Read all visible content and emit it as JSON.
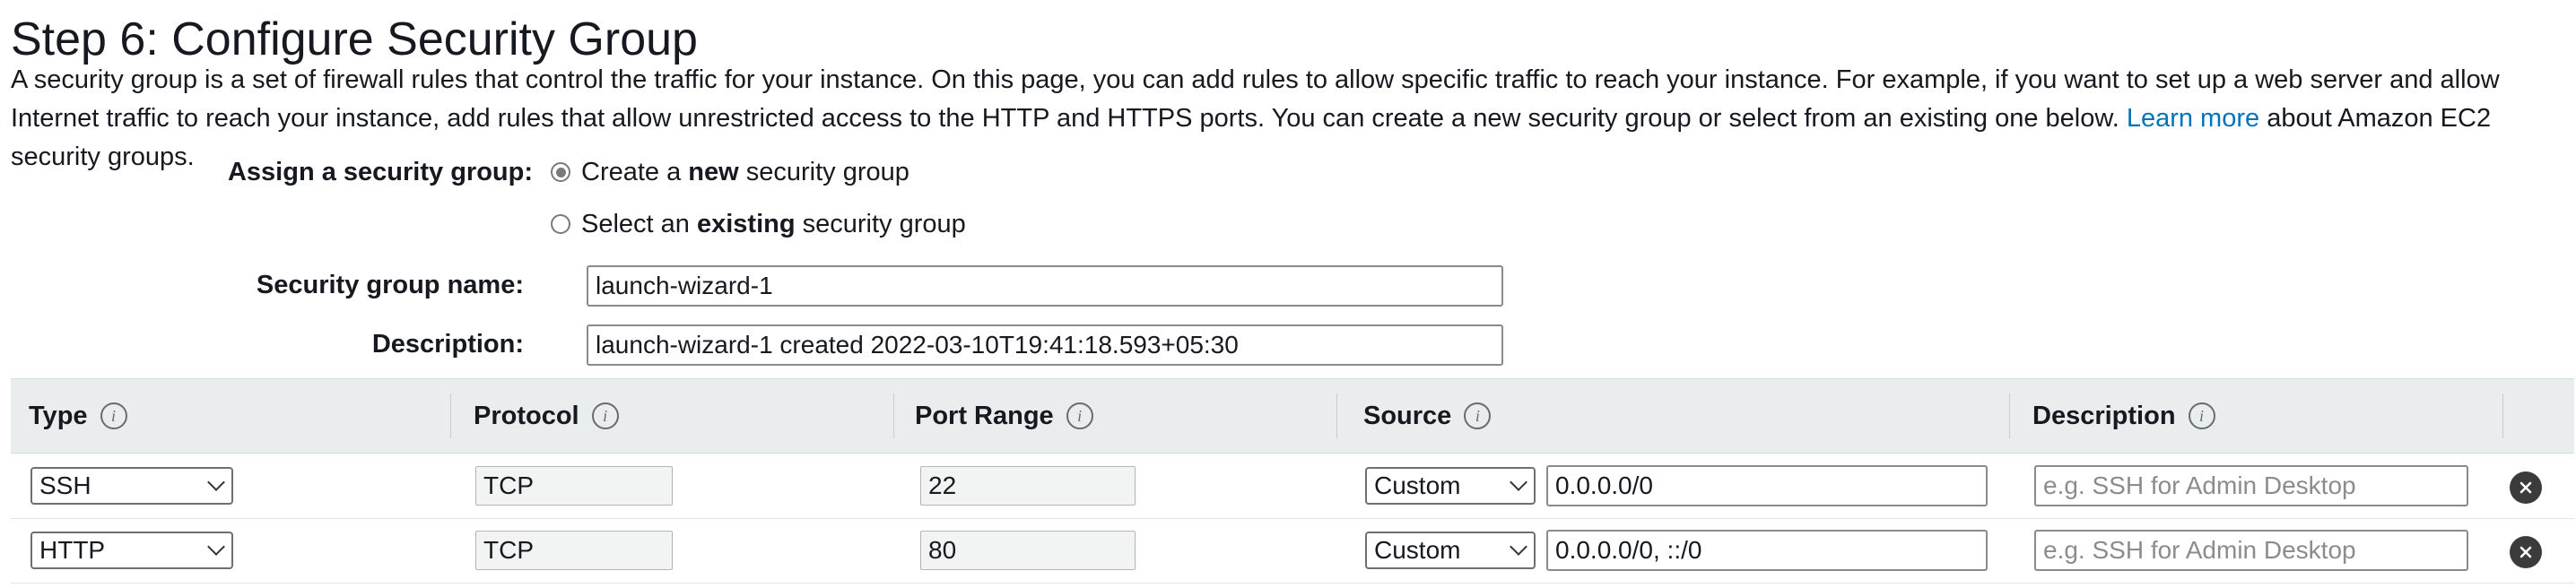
{
  "heading": "Step 6: Configure Security Group",
  "intro": {
    "text_before": "A security group is a set of firewall rules that control the traffic for your instance. On this page, you can add rules to allow specific traffic to reach your instance. For example, if you want to set up a web server and allow Internet traffic to reach your instance, add rules that allow unrestricted access to the HTTP and HTTPS ports. You can create a new security group or select from an existing one below.",
    "link": "Learn more",
    "text_after": "about Amazon EC2 security groups."
  },
  "assign": {
    "label": "Assign a security group:",
    "options": [
      {
        "prefix": "Create a ",
        "bold": "new",
        "suffix": " security group",
        "selected": true
      },
      {
        "prefix": "Select an ",
        "bold": "existing",
        "suffix": " security group",
        "selected": false
      }
    ]
  },
  "group_name": {
    "label": "Security group name:",
    "value": "launch-wizard-1"
  },
  "group_description": {
    "label": "Description:",
    "value": "launch-wizard-1 created 2022-03-10T19:41:18.593+05:30"
  },
  "table": {
    "headers": {
      "type": "Type",
      "protocol": "Protocol",
      "port_range": "Port Range",
      "source": "Source",
      "description": "Description"
    },
    "rows": [
      {
        "type": "SSH",
        "protocol": "TCP",
        "port": "22",
        "source_type": "Custom",
        "source_value": "0.0.0.0/0",
        "description_placeholder": "e.g. SSH for Admin Desktop"
      },
      {
        "type": "HTTP",
        "protocol": "TCP",
        "port": "80",
        "source_type": "Custom",
        "source_value": "0.0.0.0/0, ::/0",
        "description_placeholder": "e.g. SSH for Admin Desktop"
      }
    ]
  },
  "colors": {
    "link": "#0073bb",
    "header_bg": "#eaeded"
  }
}
